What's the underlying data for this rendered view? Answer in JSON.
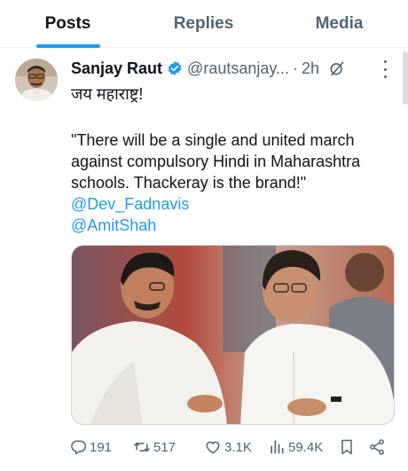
{
  "tabs": [
    {
      "label": "Posts",
      "active": true
    },
    {
      "label": "Replies",
      "active": false
    },
    {
      "label": "Media",
      "active": false
    }
  ],
  "tweet": {
    "author_name": "Sanjay Raut",
    "handle": "@rautsanjay...",
    "separator": "·",
    "time": "2h",
    "line1": "जय महाराष्ट्र!",
    "quote": "\"There will be a single and united march against compulsory Hindi in Maharashtra schools. Thackeray is the brand!\"",
    "mentions": [
      "@Dev_Fadnavis",
      "@AmitShah"
    ]
  },
  "actions": {
    "replies": "191",
    "reposts": "517",
    "likes": "3.1K",
    "views": "59.4K"
  },
  "colors": {
    "accent": "#1d9bf0",
    "text": "#0f1419",
    "secondary": "#536471",
    "border": "#eff3f4"
  },
  "icons": [
    "verified-badge-icon",
    "grok-icon",
    "more-icon",
    "reply-icon",
    "repost-icon",
    "like-icon",
    "views-icon",
    "bookmark-icon",
    "share-icon"
  ]
}
